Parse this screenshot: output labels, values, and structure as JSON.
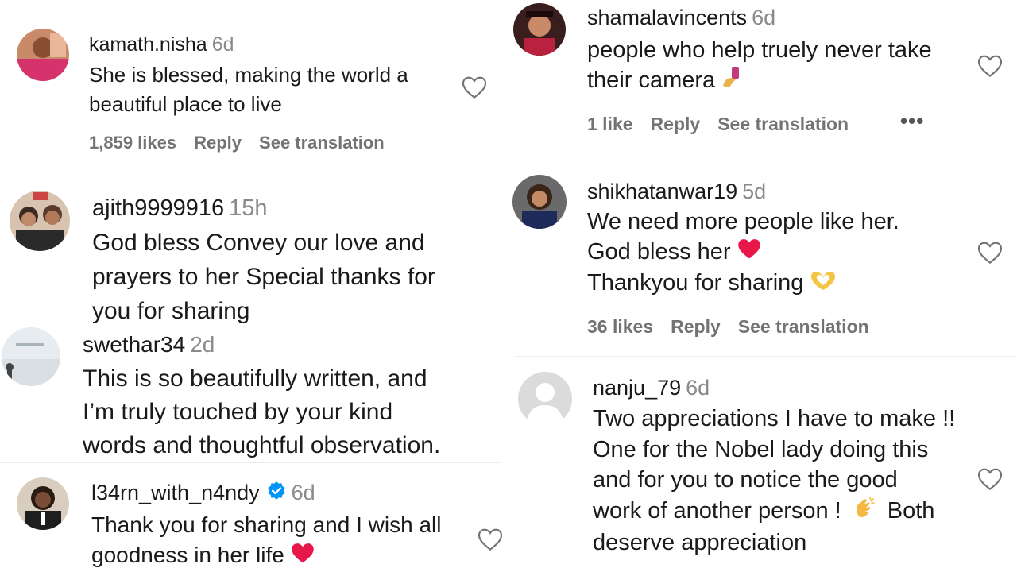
{
  "comments": {
    "kamath": {
      "username": "kamath.nisha",
      "time": "6d",
      "lines": [
        "She is blessed, making the world a",
        "beautiful place to live"
      ],
      "likes": "1,859 likes",
      "reply": "Reply",
      "translation": "See translation"
    },
    "ajith": {
      "username": "ajith9999916",
      "time": "15h",
      "lines": [
        "God bless Convey our love and",
        "prayers to her Special thanks for",
        "you for sharing"
      ]
    },
    "swethar": {
      "username": "swethar34",
      "time": "2d",
      "lines": [
        "This is so beautifully written, and",
        "I’m truly touched by your kind",
        "words and thoughtful observation."
      ]
    },
    "learn": {
      "username": "l34rn_with_n4ndy",
      "time": "6d",
      "lines": [
        "Thank you for sharing and I wish all",
        "goodness in her life"
      ]
    },
    "shamala": {
      "username": "shamalavincents",
      "time": "6d",
      "lines": [
        "people who help truely never take",
        "their camera"
      ],
      "likes": "1 like",
      "reply": "Reply",
      "translation": "See translation",
      "more": "•••"
    },
    "shikha": {
      "username": "shikhatanwar19",
      "time": "5d",
      "lines": [
        "We need more people like her.",
        "God bless her",
        "Thankyou for sharing"
      ],
      "likes": "36 likes",
      "reply": "Reply",
      "translation": "See translation"
    },
    "nanju": {
      "username": "nanju_79",
      "time": "6d",
      "lines": [
        "Two appreciations I have to make !!",
        "One for the Nobel lady doing this",
        "and for you to notice the good",
        "work of another person !",
        "Both",
        "deserve appreciation"
      ]
    }
  },
  "icons": {
    "heart": "heart-outline-icon",
    "red_heart": "red-heart-emoji",
    "selfie": "selfie-hand-emoji",
    "heart_hands": "heart-hands-emoji",
    "clap": "clapping-hands-emoji",
    "verified": "verified-badge-icon",
    "more": "more-options-icon"
  },
  "colors": {
    "text": "#1a1a1a",
    "muted": "#737373",
    "time": "#8a8a8a",
    "verified": "#0095f6",
    "heart_emoji": "#e8174a"
  }
}
